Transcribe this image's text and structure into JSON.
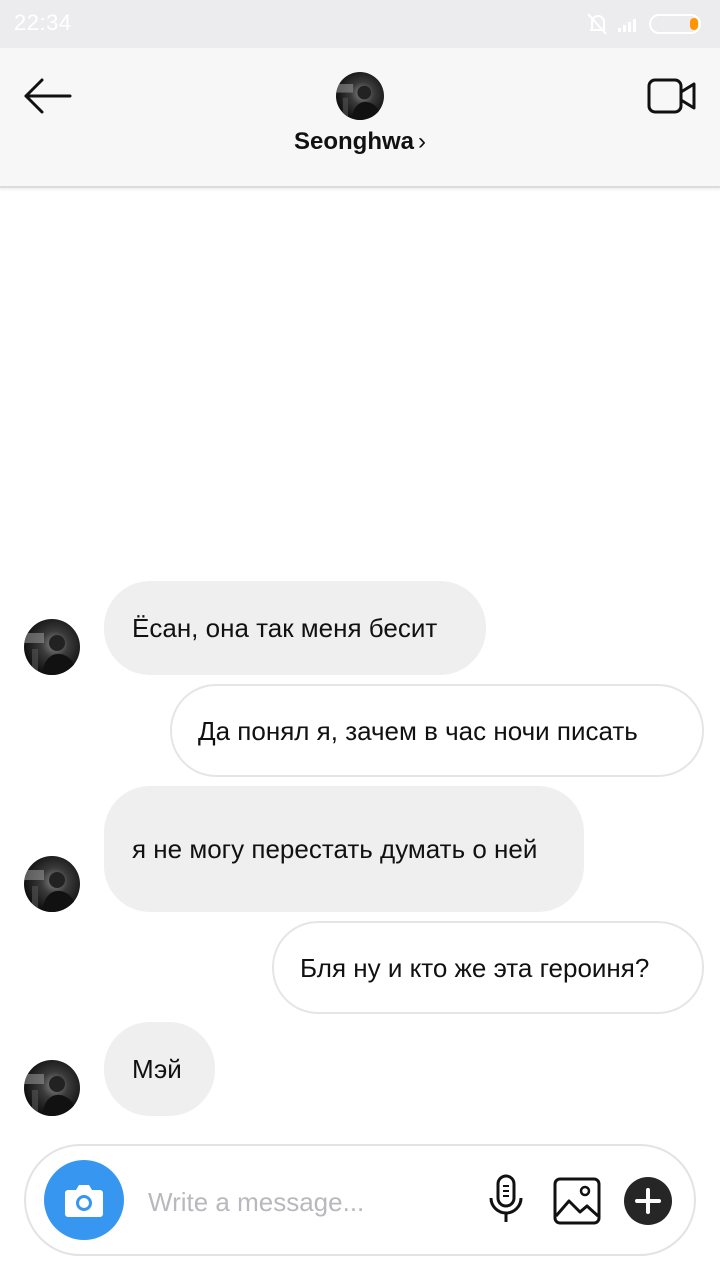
{
  "status_bar": {
    "time": "22:34"
  },
  "header": {
    "name": "Seonghwa",
    "chevron": "›",
    "icons": {
      "back": "arrow-left-icon",
      "video": "video-camera-icon"
    }
  },
  "messages": [
    {
      "from": "them",
      "text": "Ёсан, она так меня бесит"
    },
    {
      "from": "me",
      "text": "Да понял я, зачем в час ночи писать"
    },
    {
      "from": "them",
      "text": "я не могу перестать думать о ней"
    },
    {
      "from": "me",
      "text": "Бля ну и кто же эта героиня?"
    },
    {
      "from": "them",
      "text": "Мэй"
    }
  ],
  "composer": {
    "placeholder": "Write a message...",
    "icons": {
      "camera": "camera-icon",
      "mic": "microphone-icon",
      "gallery": "image-icon",
      "plus": "plus-icon"
    }
  },
  "colors": {
    "accent": "#3797f0",
    "incoming_bubble": "#efeff0",
    "outgoing_border": "#e5e5e8",
    "header_bg": "#f7f7f8",
    "status_bar_bg": "#ececee"
  }
}
